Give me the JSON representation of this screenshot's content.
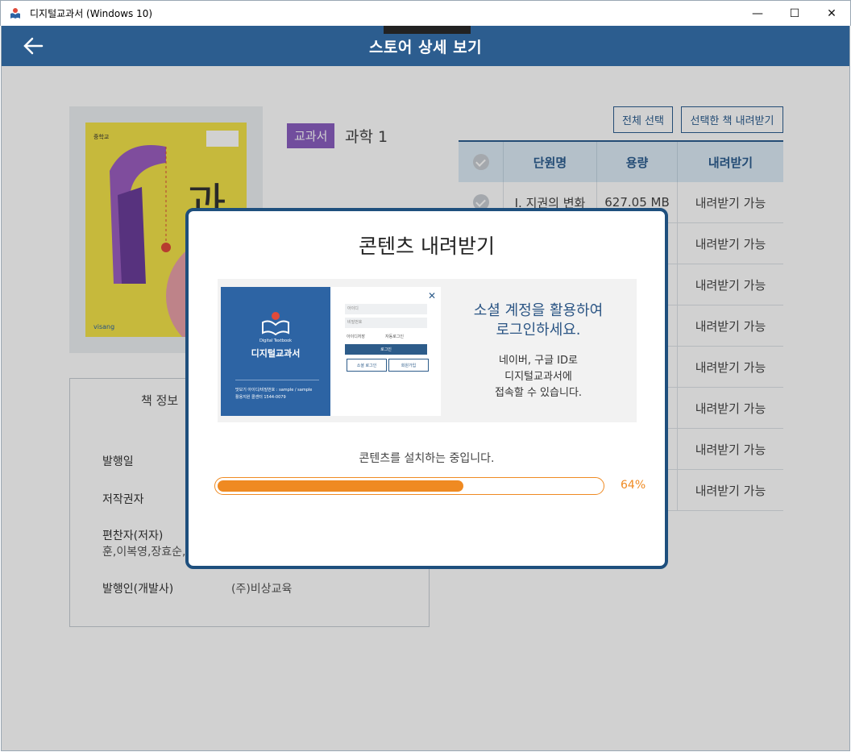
{
  "window": {
    "title": "디지털교과서 (Windows 10)",
    "controls": {
      "minimize": "—",
      "maximize": "☐",
      "close": "✕"
    }
  },
  "header": {
    "title": "스토어 상세 보기"
  },
  "book": {
    "category_badge": "교과서",
    "title": "과학 1",
    "cover_text": "과",
    "cover_publisher": "visang",
    "cover_label": "중학교"
  },
  "info": {
    "heading": "책 정보",
    "rows": [
      {
        "label": "발행일",
        "value": ""
      },
      {
        "label": "저작권자",
        "value": ""
      },
      {
        "label": "편찬자(저자)",
        "value": "훈,이복영,장효순,"
      },
      {
        "label": "발행인(개발사)",
        "value": "(주)비상교육"
      }
    ]
  },
  "actions": {
    "select_all": "전체 선택",
    "download_selected": "선택한 책 내려받기"
  },
  "table": {
    "headers": [
      "단원명",
      "용량",
      "내려받기"
    ],
    "rows": [
      {
        "unit": "Ⅰ. 지권의 변화",
        "size": "627.05 MB",
        "status": "내려받기 가능"
      },
      {
        "unit": "",
        "size": "",
        "status": "내려받기 가능"
      },
      {
        "unit": "",
        "size": "",
        "status": "내려받기 가능"
      },
      {
        "unit": "",
        "size": "",
        "status": "내려받기 가능"
      },
      {
        "unit": "",
        "size": "",
        "status": "내려받기 가능"
      },
      {
        "unit": "",
        "size": "",
        "status": "내려받기 가능"
      },
      {
        "unit": "",
        "size": "",
        "status": "내려받기 가능"
      },
      {
        "unit": "",
        "size": "",
        "status": "내려받기 가능"
      }
    ]
  },
  "modal": {
    "title": "콘텐츠 내려받기",
    "banner": {
      "headline_line1": "소셜 계정을 활용하여",
      "headline_line2": "로그인하세요.",
      "body_line1": "네이버, 구글 ID로",
      "body_line2": "디지털교과서에",
      "body_line3": "접속할 수 있습니다.",
      "screenshot": {
        "brand": "디지털교과서",
        "brand_en": "Digital Textbook",
        "id_placeholder": "아이디",
        "pw_placeholder": "비밀번호",
        "save_id": "아이디저장",
        "auto_login": "자동로그인",
        "login": "로그인",
        "social_login": "소셜 로그인",
        "signup": "회원가입",
        "demo_line1": "맛보기 아이디/비밀번호 : sample / sample",
        "demo_line2": "활용지원 콜센터 1544-0079"
      }
    },
    "status_text": "콘텐츠를 설치하는 중입니다.",
    "progress": 0.64,
    "progress_label": "64%"
  }
}
